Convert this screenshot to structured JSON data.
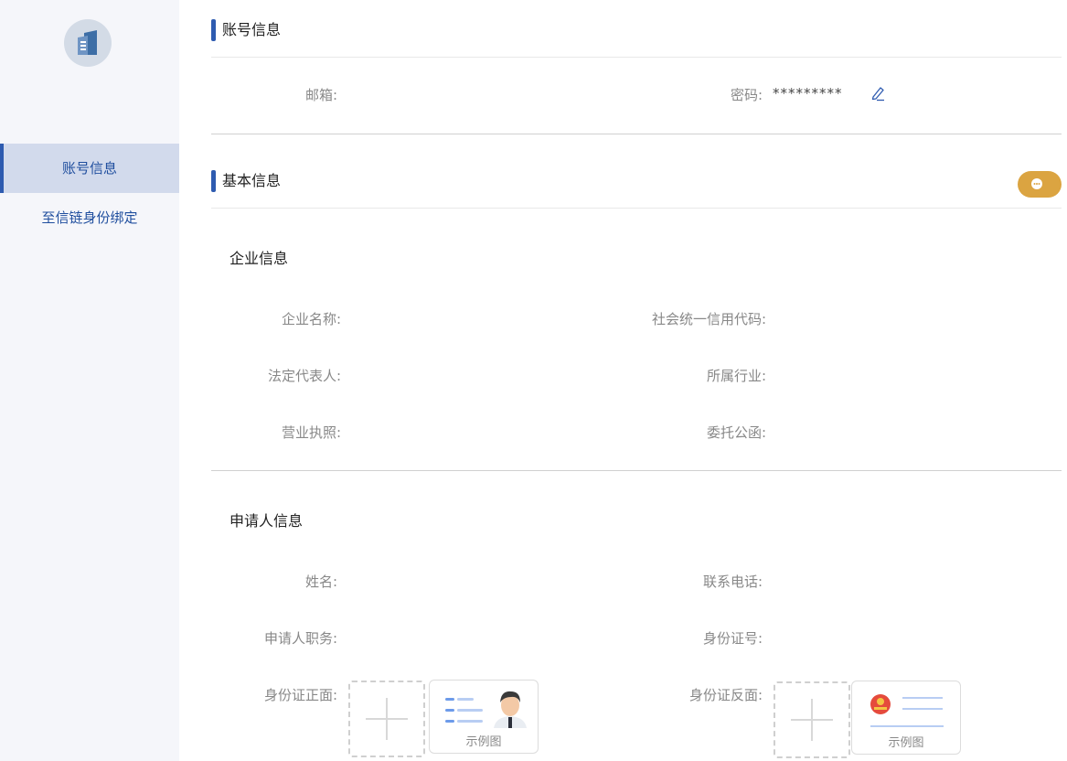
{
  "sidebar": {
    "items": [
      {
        "label": "账号信息",
        "active": true
      },
      {
        "label": "至信链身份绑定",
        "active": false
      }
    ]
  },
  "account": {
    "title": "账号信息",
    "email_label": "邮箱:",
    "email_value": "",
    "password_label": "密码:",
    "password_value": "*********"
  },
  "basic": {
    "title": "基本信息",
    "company": {
      "title": "企业信息",
      "name_label": "企业名称:",
      "credit_code_label": "社会统一信用代码:",
      "legal_rep_label": "法定代表人:",
      "industry_label": "所属行业:",
      "license_label": "营业执照:",
      "entrust_label": "委托公函:"
    },
    "applicant": {
      "title": "申请人信息",
      "name_label": "姓名:",
      "phone_label": "联系电话:",
      "position_label": "申请人职务:",
      "id_no_label": "身份证号:",
      "id_front_label": "身份证正面:",
      "id_back_label": "身份证反面:",
      "sample_caption": "示例图"
    }
  },
  "colors": {
    "accent": "#2e5bb0",
    "chat_button": "#dba441"
  }
}
